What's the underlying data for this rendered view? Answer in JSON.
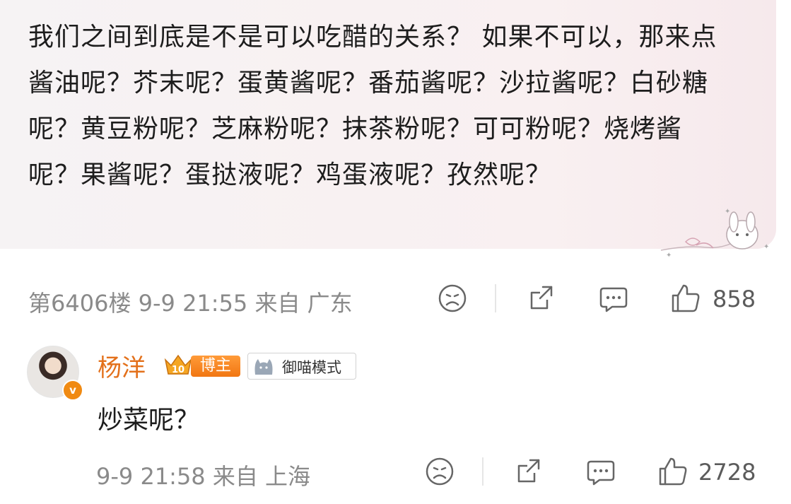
{
  "post": {
    "text": "我们之间到底是不是可以吃醋的关系？ 如果不可以，那来点酱油呢？芥末呢？蛋黄酱呢？番茄酱呢？沙拉酱呢？白砂糖呢？黄豆粉呢？芝麻粉呢？抹茶粉呢？可可粉呢？烧烤酱呢？果酱呢？蛋挞液呢？鸡蛋液呢？孜然呢？",
    "floor": "第6406楼",
    "datetime": "9-9 21:55",
    "source_prefix": "来自",
    "location": "广东",
    "like_count": "858"
  },
  "reply": {
    "username": "杨洋",
    "badge_level": "10",
    "badge_role": "博主",
    "badge_mode": "御喵模式",
    "verified_mark": "v",
    "text": "炒菜呢？",
    "datetime": "9-9 21:58",
    "source_prefix": "来自",
    "location": "上海",
    "like_count": "2728"
  },
  "icons": [
    "sad-face-icon",
    "share-icon",
    "comment-icon",
    "thumbs-up-icon",
    "sticker-bunny-icon",
    "crown-badge-icon",
    "cat-icon"
  ],
  "colors": {
    "username": "#e3701a",
    "meta": "#8a8a8a",
    "bubble": "#f7f0f2",
    "badge": "#f17612"
  }
}
